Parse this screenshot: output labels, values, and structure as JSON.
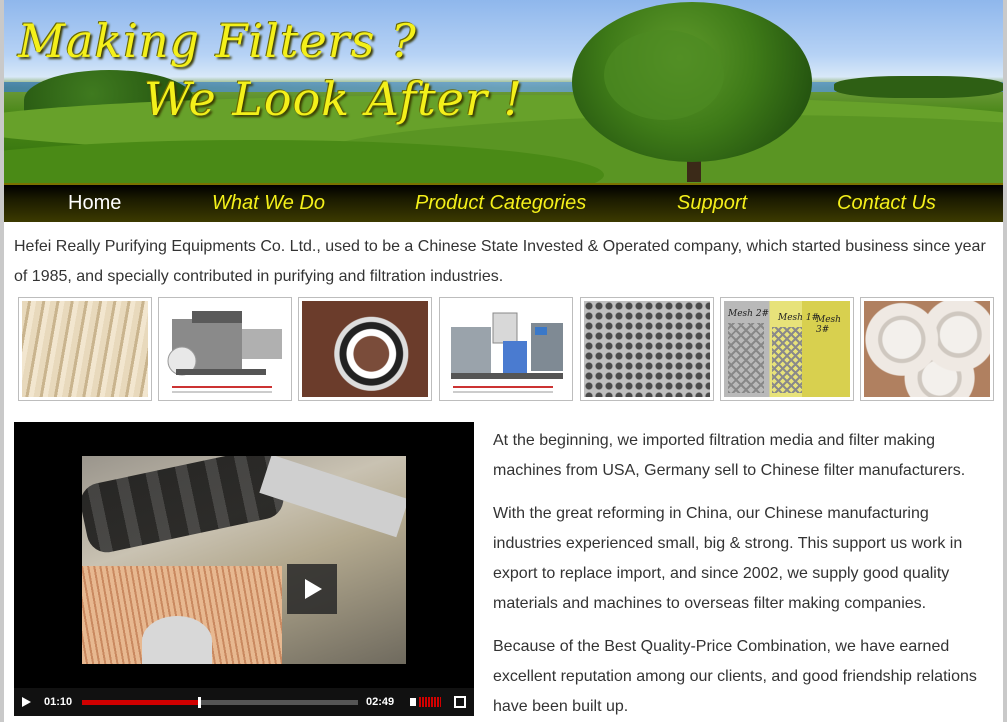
{
  "banner": {
    "line1": "Making Filters ?",
    "line2": "We Look After !"
  },
  "nav": {
    "items": [
      "Home",
      "What We Do",
      "Product Categories",
      "Support",
      "Contact Us"
    ],
    "active": "Home"
  },
  "intro": "Hefei Really Purifying Equipments Co. Ltd., used to be a Chinese State Invested & Operated company, which started business since year of 1985, and specially contributed in purifying and filtration industries.",
  "thumbnails": [
    {
      "name": "pleated-filter-media-thumb"
    },
    {
      "name": "filter-pleating-machine-thumb"
    },
    {
      "name": "rubber-gasket-ring-thumb"
    },
    {
      "name": "filter-curing-machine-thumb"
    },
    {
      "name": "perforated-metal-sheet-thumb"
    },
    {
      "name": "expanded-metal-mesh-thumb",
      "tags": [
        "Mesh 2#",
        "Mesh 1#",
        "Mesh 3#"
      ]
    },
    {
      "name": "plastic-end-caps-thumb"
    }
  ],
  "video": {
    "current_time": "01:10",
    "duration": "02:49",
    "progress": 0.42
  },
  "story": [
    "At the beginning, we imported filtration media and filter making machines from USA, Germany sell to Chinese filter manufacturers.",
    "With the great reforming in China, our Chinese manufacturing industries experienced small, big & strong. This support us work in export to replace import, and since 2002, we supply good quality materials and machines to overseas filter making companies.",
    "Because of the Best Quality-Price Combination, we have earned excellent reputation among our clients, and good friendship relations have been built up."
  ],
  "colors": {
    "accent_yellow": "#f4f01a",
    "nav_bg": "#1c1c00",
    "progress_red": "#d00000"
  }
}
